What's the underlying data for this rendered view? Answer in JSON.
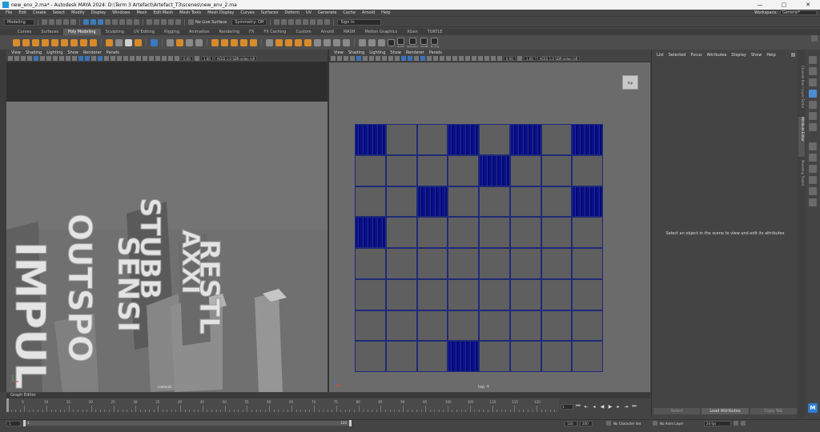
{
  "window": {
    "title": "new_env_2.ma* - Autodesk MAYA 2024: D:\\Term 3 Artefact\\Artefact_T3\\scenes\\new_env_2.ma",
    "controls": [
      "—",
      "▢",
      "✕"
    ]
  },
  "menubar": [
    "File",
    "Edit",
    "Create",
    "Select",
    "Modify",
    "Display",
    "Windows",
    "Mesh",
    "Edit Mesh",
    "Mesh Tools",
    "Mesh Display",
    "Curves",
    "Surfaces",
    "Deform",
    "UV",
    "Generate",
    "Cache",
    "Arnold",
    "Help"
  ],
  "workspace": {
    "label": "Workspace:",
    "value": "General*"
  },
  "statusline": {
    "mode": "Modeling",
    "no_live_surface": "No Live Surface",
    "symmetry": "Symmetry: Off",
    "sign_in": "Sign In"
  },
  "shelf_tabs": [
    "Curves",
    "Surfaces",
    "Poly Modeling",
    "Sculpting",
    "UV Editing",
    "Rigging",
    "Animation",
    "Rendering",
    "FX",
    "FX Caching",
    "Custom",
    "Arnold",
    "MASH",
    "Motion Graphics",
    "XGen",
    "TURTLE"
  ],
  "shelf_active": "Poly Modeling",
  "shelf_mini_labels": [
    "w_full",
    "sysqueus",
    "mouth",
    "kt_ung"
  ],
  "viewport_menu": [
    "View",
    "Shading",
    "Lighting",
    "Show",
    "Renderer",
    "Panels"
  ],
  "viewport_left": {
    "num1": "0.00",
    "num2": "1.00",
    "aces": "ACES 1.0 SDR-video (sR",
    "camera_label": "camera1",
    "words": [
      "IMPULS",
      "OUTSPO",
      "SENSI",
      "STUBB",
      "AXXI",
      "RESTL"
    ]
  },
  "viewport_right": {
    "num1": "0.00",
    "num2": "1.00",
    "aces": "ACES 1.0 SDR-video (sR",
    "camera_label": "top -Y",
    "view_cube": "top",
    "filled_cells": [
      [
        0,
        0
      ],
      [
        3,
        0
      ],
      [
        5,
        0
      ],
      [
        7,
        0
      ],
      [
        4,
        1
      ],
      [
        2,
        2
      ],
      [
        7,
        2
      ],
      [
        0,
        3
      ],
      [
        3,
        7
      ]
    ]
  },
  "attribute_editor": {
    "menu": [
      "List",
      "Selected",
      "Focus",
      "Attributes",
      "Display",
      "Show",
      "Help"
    ],
    "message": "Select an object in the scene to view and edit its attributes",
    "buttons": [
      "Select",
      "Load Attributes",
      "Copy Tab"
    ]
  },
  "side_tabs": [
    "Channel Box / Layer Editor",
    "Attribute Editor",
    "Modeling Toolkit"
  ],
  "timeline": {
    "label": "Graph Editor",
    "ticks": [
      "5",
      "10",
      "15",
      "20",
      "25",
      "30",
      "35",
      "40",
      "45",
      "50",
      "55",
      "60",
      "65",
      "70",
      "75",
      "80",
      "85",
      "90",
      "95",
      "100",
      "105",
      "110",
      "115",
      "120"
    ],
    "current_frame": "1"
  },
  "range": {
    "start": "1",
    "inner_start": "1",
    "inner_end": "120",
    "end_inner": "120",
    "end": "200",
    "character_set": "No Character Set",
    "anim_layer": "No Anim Layer",
    "fps": "24 fps"
  }
}
